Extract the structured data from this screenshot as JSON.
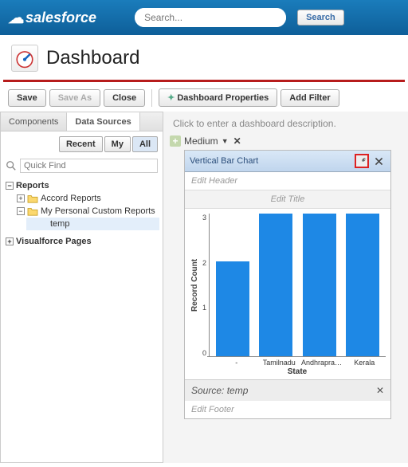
{
  "header": {
    "logo_text": "salesforce",
    "search_placeholder": "Search...",
    "search_button": "Search"
  },
  "page": {
    "title": "Dashboard"
  },
  "toolbar": {
    "save": "Save",
    "save_as": "Save As",
    "close": "Close",
    "properties": "Dashboard Properties",
    "add_filter": "Add Filter"
  },
  "sidebar": {
    "tabs": {
      "components": "Components",
      "data_sources": "Data Sources"
    },
    "filters": {
      "recent": "Recent",
      "my": "My",
      "all": "All"
    },
    "quick_find_placeholder": "Quick Find",
    "tree": {
      "reports_label": "Reports",
      "accord_label": "Accord Reports",
      "my_custom_label": "My Personal Custom Reports",
      "temp_label": "temp",
      "vf_label": "Visualforce Pages"
    }
  },
  "canvas": {
    "description_prompt": "Click to enter a dashboard description.",
    "column_size": "Medium"
  },
  "widget": {
    "title": "Vertical Bar Chart",
    "edit_header": "Edit Header",
    "edit_title": "Edit Title",
    "edit_footer": "Edit Footer",
    "source_label": "Source: temp"
  },
  "chart_data": {
    "type": "bar",
    "title": "",
    "xlabel": "State",
    "ylabel": "Record Count",
    "ylim": [
      0,
      3
    ],
    "yticks": [
      0,
      1,
      2,
      3
    ],
    "categories": [
      "-",
      "Tamilnadu",
      "Andhraprade..",
      "Kerala"
    ],
    "values": [
      2,
      3,
      3,
      3
    ]
  }
}
